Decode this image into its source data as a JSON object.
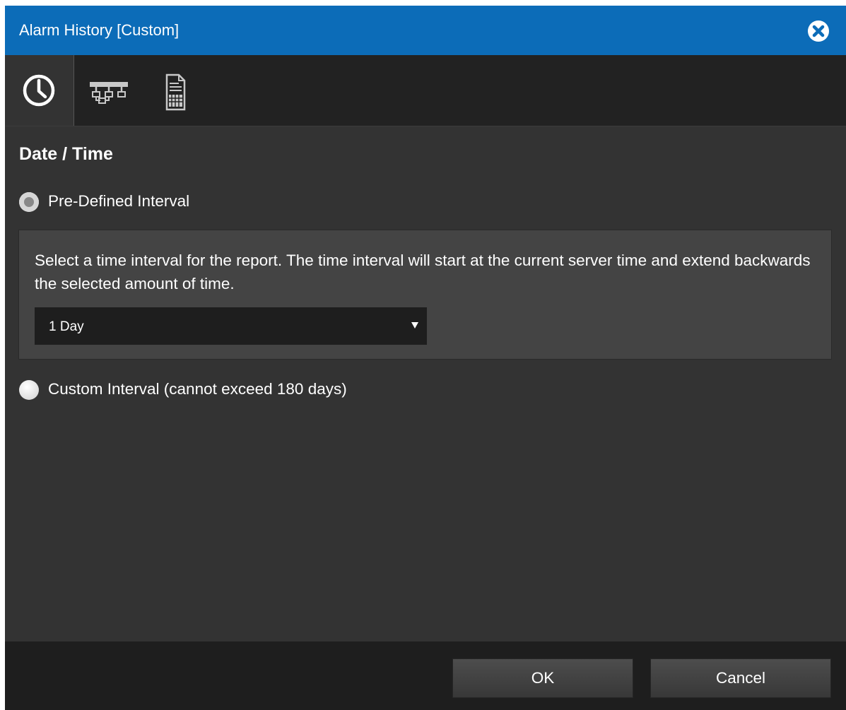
{
  "dialog": {
    "title": "Alarm History [Custom]",
    "close_icon": "close-circle-icon"
  },
  "toolbar": {
    "tabs": [
      {
        "name": "clock-icon",
        "active": true
      },
      {
        "name": "hierarchy-icon",
        "active": false
      },
      {
        "name": "report-document-icon",
        "active": false
      }
    ]
  },
  "section": {
    "title": "Date / Time"
  },
  "predefined": {
    "label": "Pre-Defined Interval",
    "checked": true,
    "description": "Select a time interval for the report. The time interval will start at the current server time and extend backwards the selected amount of time.",
    "selected_value": "1 Day"
  },
  "custom": {
    "label": "Custom Interval (cannot exceed 180 days)",
    "checked": false
  },
  "footer": {
    "ok_label": "OK",
    "cancel_label": "Cancel"
  },
  "colors": {
    "titlebar": "#0c6cb8",
    "body": "#333333",
    "toolbar": "#222222",
    "panel": "#444444",
    "footer": "#1e1e1e"
  }
}
